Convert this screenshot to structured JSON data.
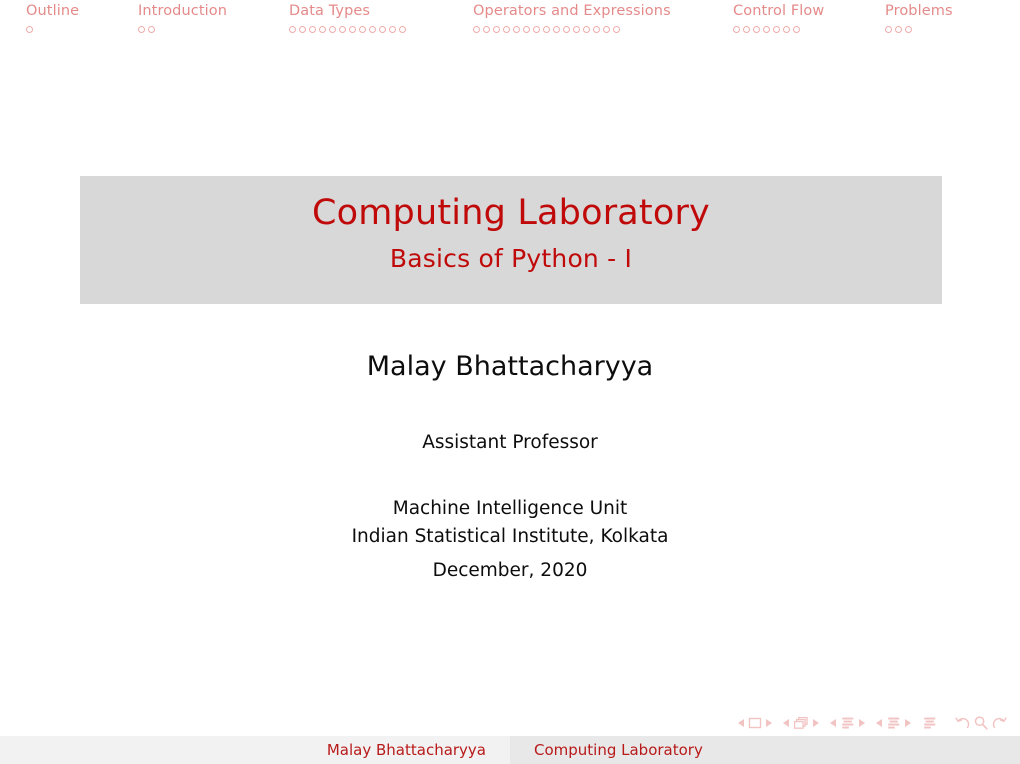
{
  "slide": {
    "kind": "beamer-title-slide",
    "background_color": "#FFFFFF"
  },
  "colors": {
    "title_red": "#C00A0A",
    "nav_inactive_red": "#E58A8A",
    "nav_dot_red": "#EFACAC",
    "nav_symbol_red": "#F2C3C3",
    "title_block_gray": "#D8D8D8",
    "footline_left_gray": "#F2F2F2",
    "footline_right_gray": "#E8E8E8",
    "footline_text_red": "#B81A1A",
    "body_text": "#0D0D0D"
  },
  "headline": {
    "sections": [
      {
        "label": "Outline",
        "slide_count": 1
      },
      {
        "label": "Introduction",
        "slide_count": 2
      },
      {
        "label": "Data Types",
        "slide_count": 12
      },
      {
        "label": "Operators and Expressions",
        "slide_count": 15
      },
      {
        "label": "Control Flow",
        "slide_count": 7
      },
      {
        "label": "Problems",
        "slide_count": 3
      }
    ]
  },
  "title_block": {
    "title": "Computing Laboratory",
    "subtitle": "Basics of Python - I"
  },
  "author_block": {
    "name": "Malay Bhattacharyya",
    "designation": "Assistant Professor",
    "affiliation_lines": [
      "Machine Intelligence Unit",
      "Indian Statistical Institute, Kolkata"
    ],
    "date": "December, 2020"
  },
  "navigation_symbols": {
    "groups": [
      {
        "name": "slide-navigation",
        "icon": "square-frame-icon",
        "prev": "previous-slide-arrow",
        "next": "next-slide-arrow"
      },
      {
        "name": "frame-navigation",
        "icon": "stacked-frames-icon",
        "prev": "previous-frame-arrow",
        "next": "next-frame-arrow"
      },
      {
        "name": "subsection-navigation",
        "icon": "subsection-lines-icon",
        "prev": "previous-subsection-arrow",
        "next": "next-subsection-arrow"
      },
      {
        "name": "section-navigation",
        "icon": "section-lines-icon",
        "prev": "previous-section-arrow",
        "next": "next-section-arrow"
      }
    ],
    "document_icon": "document-lines-icon",
    "back_icon": "back-arrow-icon",
    "search_icon": "search-icon",
    "forward_icon": "forward-arrow-icon"
  },
  "footline": {
    "author": "Malay Bhattacharyya",
    "title": "Computing Laboratory"
  }
}
